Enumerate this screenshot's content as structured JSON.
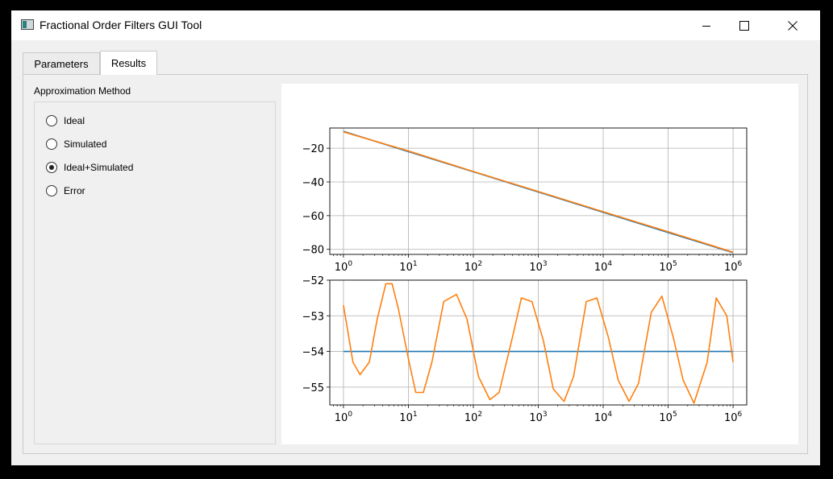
{
  "window": {
    "title": "Fractional Order Filters GUI Tool",
    "icon": "app-window-icon",
    "controls": [
      "minimize-icon",
      "maximize-icon",
      "close-icon"
    ]
  },
  "tabs": [
    {
      "label": "Parameters",
      "active": false
    },
    {
      "label": "Results",
      "active": true
    }
  ],
  "approximation": {
    "title": "Approximation Method",
    "options": [
      {
        "label": "Ideal",
        "checked": false
      },
      {
        "label": "Simulated",
        "checked": false
      },
      {
        "label": "Ideal+Simulated",
        "checked": true
      },
      {
        "label": "Error",
        "checked": false
      }
    ]
  },
  "colors": {
    "ideal": "#1f77b4",
    "simulated": "#ff7f0e"
  },
  "chart_data": [
    {
      "type": "line",
      "xscale": "log",
      "xlim": [
        1,
        1000000
      ],
      "xticks": [
        "10^0",
        "10^1",
        "10^2",
        "10^3",
        "10^4",
        "10^5",
        "10^6"
      ],
      "ylim": [
        -83,
        -8
      ],
      "yticks": [
        -20,
        -40,
        -60,
        -80
      ],
      "grid": true,
      "series": [
        {
          "x": [
            1,
            10,
            100,
            1000,
            10000,
            100000,
            1000000
          ],
          "y": [
            -10,
            -22,
            -34,
            -46,
            -58,
            -70,
            -82
          ]
        },
        {
          "x": [
            1,
            10,
            100,
            1000,
            10000,
            100000,
            1000000
          ],
          "y": [
            -10.3,
            -21.6,
            -33.8,
            -45.7,
            -57.7,
            -69.6,
            -81.7
          ]
        }
      ]
    },
    {
      "type": "line",
      "xscale": "log",
      "xlim": [
        1,
        1000000
      ],
      "xticks": [
        "10^0",
        "10^1",
        "10^2",
        "10^3",
        "10^4",
        "10^5",
        "10^6"
      ],
      "ylim": [
        -55.5,
        -52
      ],
      "yticks": [
        -52,
        -53,
        -54,
        -55
      ],
      "grid": true,
      "series": [
        {
          "x": [
            1,
            1000000
          ],
          "y": [
            -54,
            -54
          ]
        },
        {
          "x": [
            1,
            1.4,
            1.8,
            2.5,
            3.3,
            4.5,
            5.6,
            7,
            10,
            13,
            17,
            23,
            35,
            55,
            80,
            120,
            180,
            250,
            400,
            550,
            800,
            1200,
            1700,
            2500,
            3500,
            5500,
            8000,
            12000,
            17000,
            25000,
            35000,
            55000,
            80000,
            120000,
            170000,
            250000,
            400000,
            550000,
            800000,
            1000000
          ],
          "y": [
            -52.7,
            -54.3,
            -54.65,
            -54.3,
            -53.1,
            -52.1,
            -52.1,
            -52.8,
            -54.2,
            -55.15,
            -55.15,
            -54.3,
            -52.6,
            -52.4,
            -53.1,
            -54.7,
            -55.35,
            -55.15,
            -53.6,
            -52.5,
            -52.6,
            -53.7,
            -55.05,
            -55.4,
            -54.7,
            -52.6,
            -52.5,
            -53.6,
            -54.8,
            -55.4,
            -54.9,
            -52.9,
            -52.45,
            -53.6,
            -54.8,
            -55.45,
            -54.3,
            -52.5,
            -53.0,
            -54.3
          ]
        }
      ]
    }
  ]
}
